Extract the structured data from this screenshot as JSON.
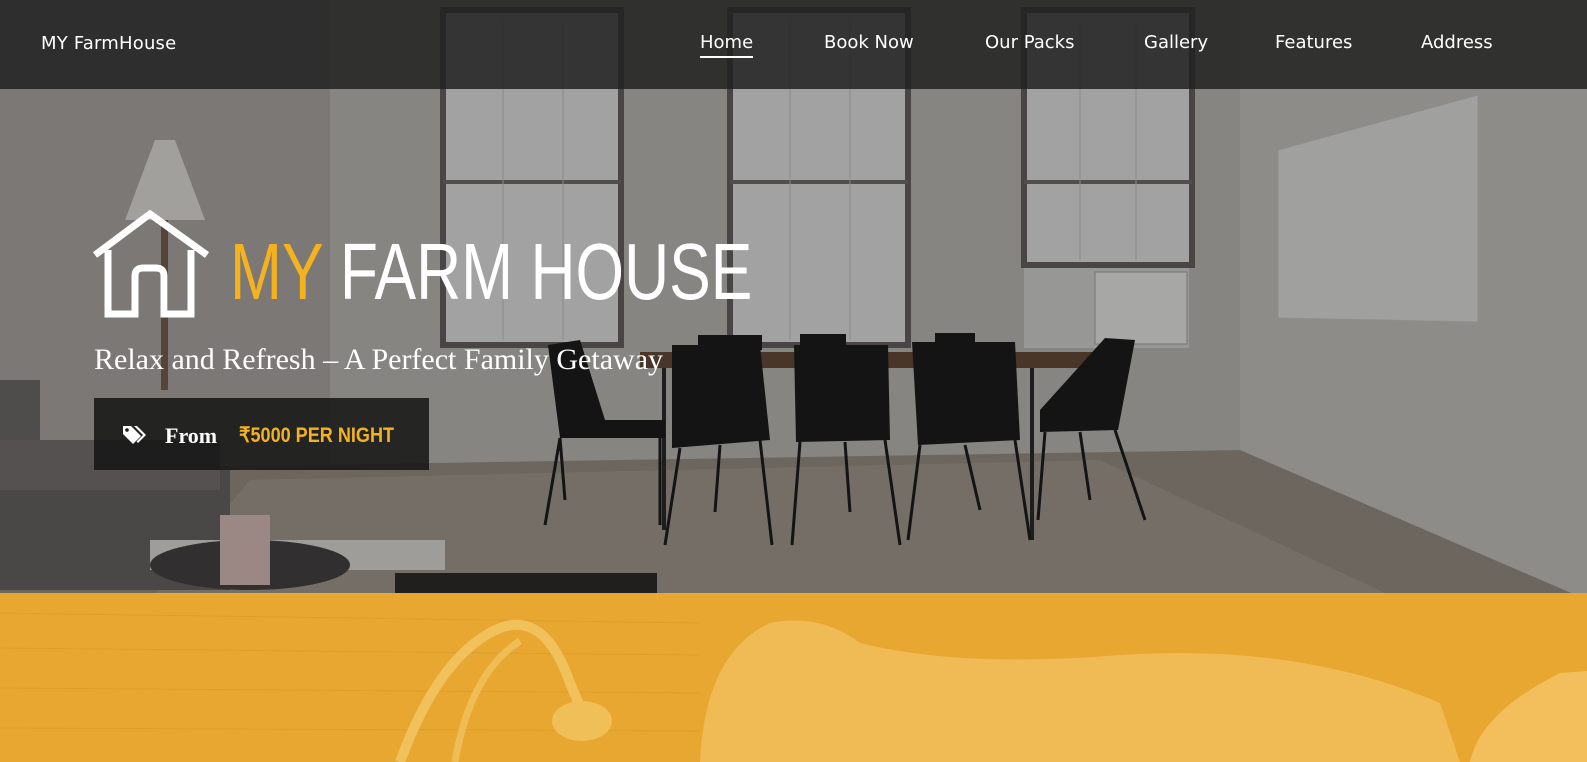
{
  "navbar": {
    "brand": "MY FarmHouse",
    "items": [
      {
        "label": "Home",
        "active": true
      },
      {
        "label": "Book Now",
        "active": false
      },
      {
        "label": "Our Packs",
        "active": false
      },
      {
        "label": "Gallery",
        "active": false
      },
      {
        "label": "Features",
        "active": false
      },
      {
        "label": "Address",
        "active": false
      }
    ]
  },
  "hero": {
    "logo_icon": "house-outline-icon",
    "logo_part1": "MY",
    "logo_part2": "FARM HOUSE",
    "tagline": "Relax and Refresh – A Perfect Family Getaway",
    "price": {
      "icon": "price-tags-icon",
      "from_label": "From",
      "value": "₹5000 PER NIGHT"
    }
  },
  "colors": {
    "accent": "#f5b21f",
    "section_yellow": "#e7a731",
    "nav_bg": "#222222"
  }
}
